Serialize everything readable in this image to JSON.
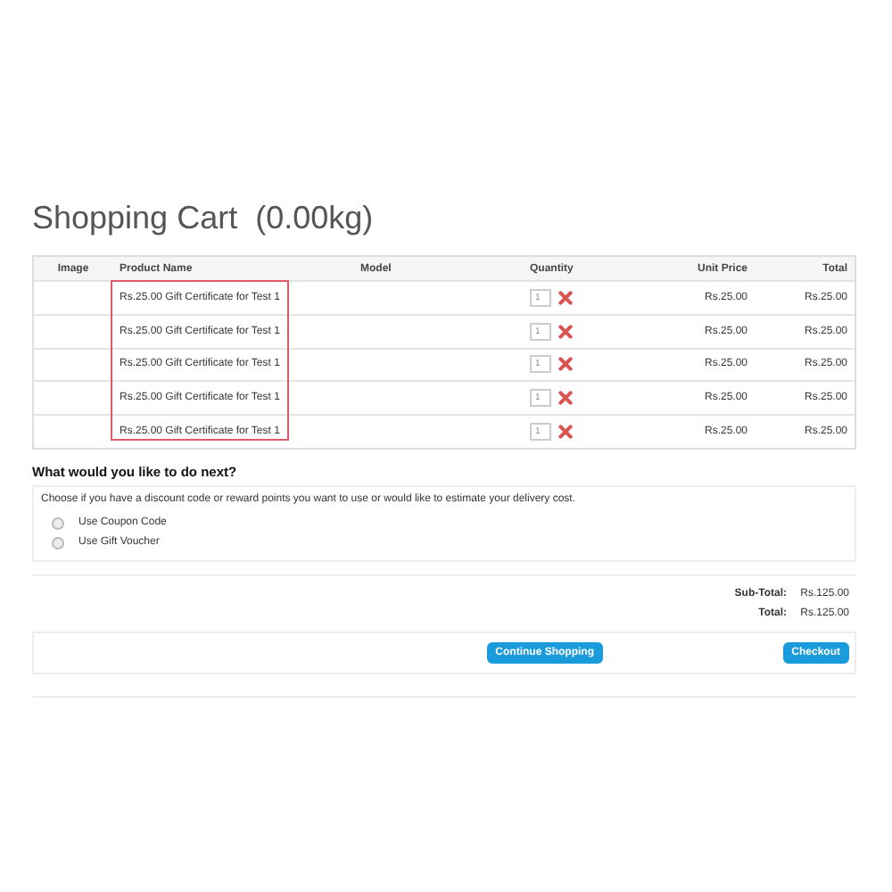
{
  "title": "Shopping Cart  (0.00kg)",
  "table": {
    "columns": [
      "Image",
      "Product Name",
      "Model",
      "Quantity",
      "Unit Price",
      "Total"
    ],
    "rows": [
      {
        "product": "Rs.25.00 Gift Certificate for Test 1",
        "quantity": "1",
        "unit_price": "Rs.25.00",
        "total": "Rs.25.00"
      },
      {
        "product": "Rs.25.00 Gift Certificate for Test 1",
        "quantity": "1",
        "unit_price": "Rs.25.00",
        "total": "Rs.25.00"
      },
      {
        "product": "Rs.25.00 Gift Certificate for Test 1",
        "quantity": "1",
        "unit_price": "Rs.25.00",
        "total": "Rs.25.00"
      },
      {
        "product": "Rs.25.00 Gift Certificate for Test 1",
        "quantity": "1",
        "unit_price": "Rs.25.00",
        "total": "Rs.25.00"
      },
      {
        "product": "Rs.25.00 Gift Certificate for Test 1",
        "quantity": "1",
        "unit_price": "Rs.25.00",
        "total": "Rs.25.00"
      }
    ]
  },
  "next": {
    "heading": "What would you like to do next?",
    "description": "Choose if you have a discount code or reward points you want to use or would like to estimate your delivery cost.",
    "options": [
      {
        "label": "Use Coupon Code",
        "selected": false
      },
      {
        "label": "Use Gift Voucher",
        "selected": false
      }
    ]
  },
  "totals": [
    {
      "label": "Sub-Total:",
      "value": "Rs.125.00"
    },
    {
      "label": "Total:",
      "value": "Rs.125.00"
    }
  ],
  "buttons": {
    "continue": "Continue Shopping",
    "checkout": "Checkout"
  }
}
